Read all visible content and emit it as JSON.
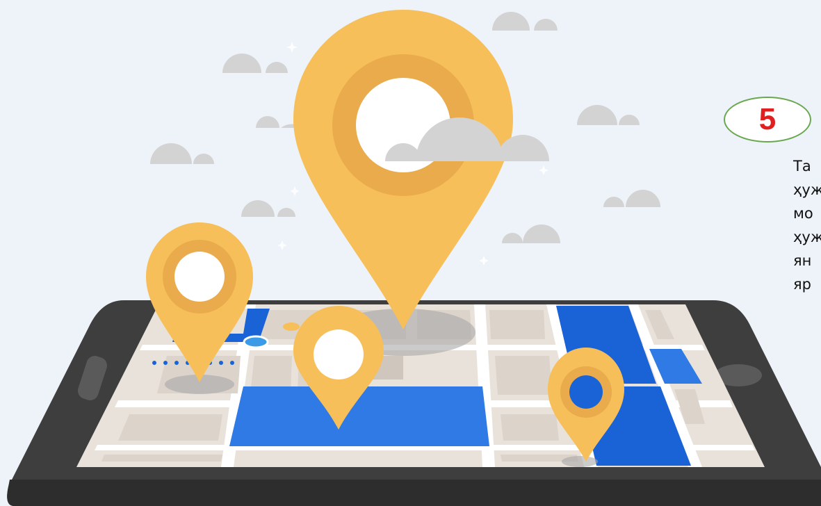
{
  "step": {
    "number": "5"
  },
  "description": {
    "lines": [
      "Та",
      "ҳуж",
      "мо",
      "ҳуж",
      "ян",
      "яр"
    ]
  },
  "icons": {
    "phone": "smartphone-icon",
    "pins": "map-pin-icon",
    "clouds": "cloud-icon"
  },
  "colors": {
    "background": "#eef3fa",
    "phone_body": "#3e3e3e",
    "map_base": "#e9e2da",
    "map_blue": "#2f7ae5",
    "map_dark_blue": "#1a63d6",
    "pin_outer": "#f6bf5a",
    "pin_inner": "#e9ab4b",
    "cloud": "#d3d3d3",
    "badge_border": "#6aa84f",
    "badge_number": "#e11f1f"
  }
}
